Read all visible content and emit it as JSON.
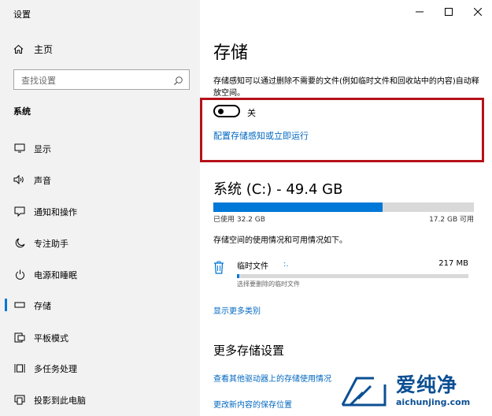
{
  "window": {
    "title": "设置",
    "buttons": {
      "minimize": "—",
      "maximize": "☐",
      "close": "✕"
    }
  },
  "sidebar": {
    "home_label": "主页",
    "search_placeholder": "查找设置",
    "section_label": "系统",
    "items": [
      {
        "label": "显示",
        "icon": "monitor-icon"
      },
      {
        "label": "声音",
        "icon": "speaker-icon"
      },
      {
        "label": "通知和操作",
        "icon": "notification-icon"
      },
      {
        "label": "专注助手",
        "icon": "moon-icon"
      },
      {
        "label": "电源和睡眠",
        "icon": "power-icon"
      },
      {
        "label": "存储",
        "icon": "storage-icon",
        "active": true
      },
      {
        "label": "平板模式",
        "icon": "tablet-icon"
      },
      {
        "label": "多任务处理",
        "icon": "multitask-icon"
      },
      {
        "label": "投影到此电脑",
        "icon": "project-icon"
      }
    ]
  },
  "main": {
    "title": "存储",
    "description": "存储感知可以通过删除不需要的文件(例如临时文件和回收站中的内容)自动释放空间。",
    "toggle": {
      "state": "off",
      "label": "关"
    },
    "configure_link": "配置存储感知或立即运行",
    "drive": {
      "title": "系统 (C:) - 49.4 GB",
      "used_label": "已使用 32.2 GB",
      "available_label": "17.2 GB 可用",
      "used_fraction": 0.65
    },
    "usage_desc": "存储空间的使用情况和可用情况如下。",
    "temp": {
      "name": "临时文件",
      "spinner": ":.",
      "size": "217 MB",
      "sub": "选择要删除的临时文件",
      "fraction": 0.01
    },
    "show_more_link": "显示更多类别",
    "more_title": "更多存储设置",
    "other_drives_link": "查看其他驱动器上的存储使用情况",
    "change_location_link": "更改新内容的保存位置"
  },
  "watermark": {
    "text": "爱纯净",
    "url": "aichunjing.com"
  },
  "colors": {
    "accent": "#0078d7",
    "link": "#0067c0",
    "highlight_border": "#b5121b",
    "sidebar_bg": "#f2f2f2"
  }
}
